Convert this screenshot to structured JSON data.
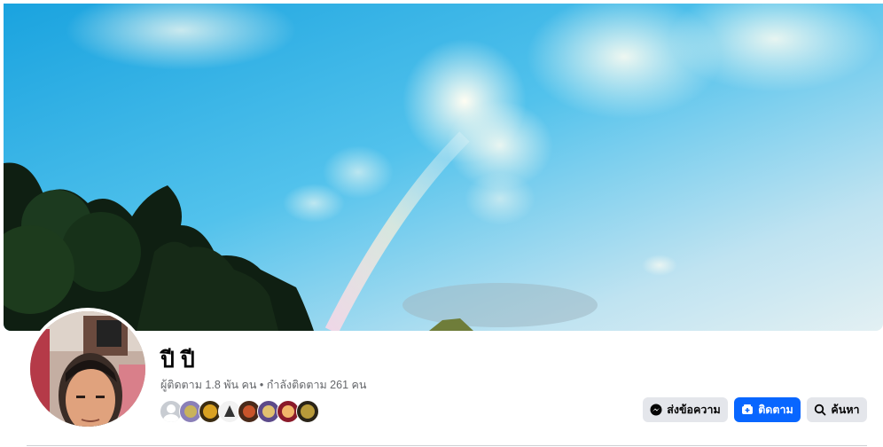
{
  "profile": {
    "name": "ปี ปี",
    "stats": "ผู้ติดตาม 1.8 พัน คน • กำลังติดตาม 261 คน"
  },
  "actions": {
    "message_label": "ส่งข้อความ",
    "follow_label": "ติดตาม",
    "search_label": "ค้นหา"
  },
  "friends_count_shown": 8,
  "colors": {
    "accent": "#0866ff",
    "button_grey": "#e4e6eb",
    "text_primary": "#050505",
    "text_secondary": "#65676b"
  },
  "icons": {
    "message": "messenger-icon",
    "follow": "follow-icon",
    "search": "search-icon"
  }
}
